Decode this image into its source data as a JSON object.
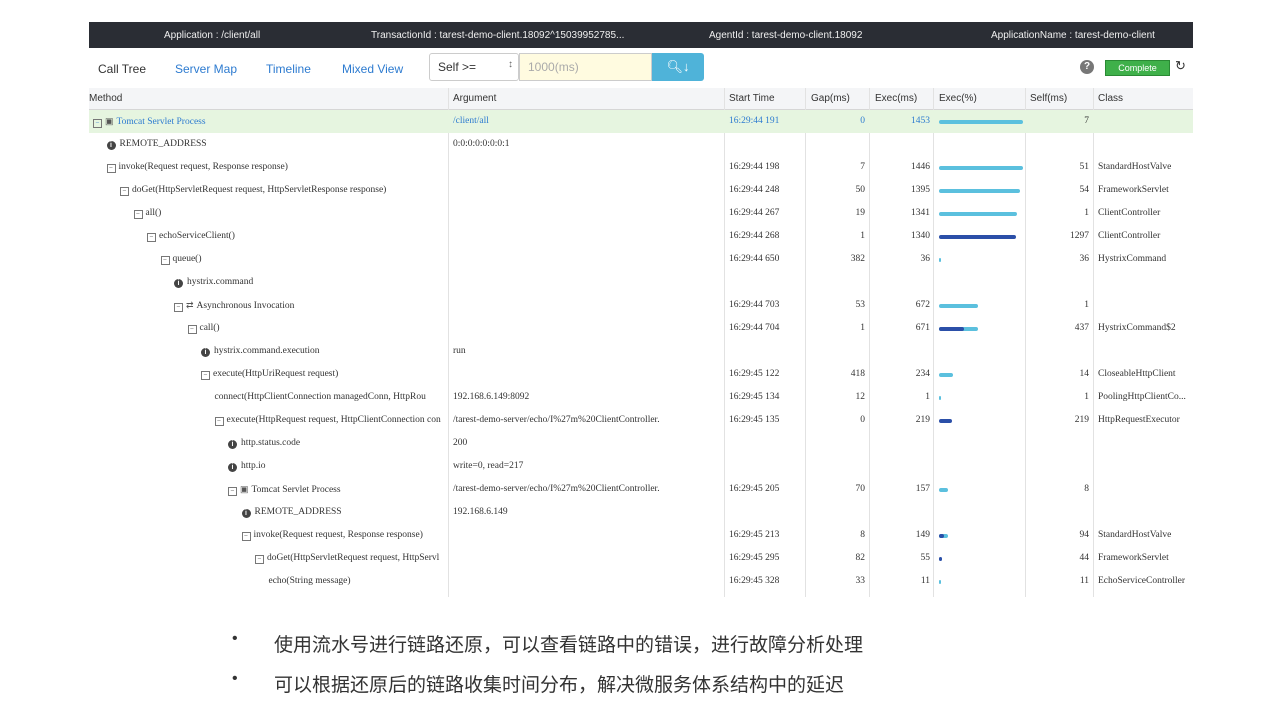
{
  "header": {
    "application": "Application : /client/all",
    "transaction": "TransactionId : tarest-demo-client.18092^15039952785...",
    "agent": "AgentId : tarest-demo-client.18092",
    "appname": "ApplicationName : tarest-demo-client"
  },
  "nav": {
    "tabs": [
      "Call Tree",
      "Server Map",
      "Timeline",
      "Mixed View"
    ],
    "filter_select": "Self >=",
    "filter_input_placeholder": "1000(ms)",
    "search_icon": "search-icon",
    "help": "?",
    "status": "Complete",
    "refresh_icon": "refresh-icon"
  },
  "columns": [
    "Method",
    "Argument",
    "Start Time",
    "Gap(ms)",
    "Exec(ms)",
    "Exec(%)",
    "Self(ms)",
    "Class"
  ],
  "rows": [
    {
      "method": "Tomcat Servlet Process",
      "arg": "/client/all",
      "start": "16:29:44 191",
      "gap": "0",
      "exec": "1453",
      "pct": 100,
      "self": "7",
      "class": "",
      "indent": 0,
      "node": "toggle-root",
      "hl": true
    },
    {
      "method": "REMOTE_ADDRESS",
      "arg": "0:0:0:0:0:0:0:1",
      "start": "",
      "gap": "",
      "exec": "",
      "pct": null,
      "self": "",
      "class": "",
      "indent": 1,
      "node": "info"
    },
    {
      "method": "invoke(Request request, Response response)",
      "arg": "",
      "start": "16:29:44 198",
      "gap": "7",
      "exec": "1446",
      "pct": 99.5,
      "self": "51",
      "class": "StandardHostValve",
      "indent": 1,
      "node": "toggle"
    },
    {
      "method": "doGet(HttpServletRequest request, HttpServletResponse response)",
      "arg": "",
      "start": "16:29:44 248",
      "gap": "50",
      "exec": "1395",
      "pct": 96,
      "self": "54",
      "class": "FrameworkServlet",
      "indent": 2,
      "node": "toggle"
    },
    {
      "method": "all()",
      "arg": "",
      "start": "16:29:44 267",
      "gap": "19",
      "exec": "1341",
      "pct": 92.3,
      "self": "1",
      "class": "ClientController",
      "indent": 3,
      "node": "toggle"
    },
    {
      "method": "echoServiceClient()",
      "arg": "",
      "start": "16:29:44 268",
      "gap": "1",
      "exec": "1340",
      "pct": 92.2,
      "self": "1297",
      "class": "ClientController",
      "indent": 4,
      "node": "toggle",
      "dark": true
    },
    {
      "method": "queue()",
      "arg": "",
      "start": "16:29:44 650",
      "gap": "382",
      "exec": "36",
      "pct": 2.5,
      "self": "36",
      "class": "HystrixCommand",
      "indent": 5,
      "node": "toggle"
    },
    {
      "method": "hystrix.command",
      "arg": "",
      "start": "",
      "gap": "",
      "exec": "",
      "pct": null,
      "self": "",
      "class": "",
      "indent": 6,
      "node": "info"
    },
    {
      "method": "Asynchronous Invocation",
      "arg": "",
      "start": "16:29:44 703",
      "gap": "53",
      "exec": "672",
      "pct": 46.2,
      "self": "1",
      "class": "",
      "indent": 6,
      "node": "toggle-async"
    },
    {
      "method": "call()",
      "arg": "",
      "start": "16:29:44 704",
      "gap": "1",
      "exec": "671",
      "pct": 46.2,
      "self": "437",
      "class": "HystrixCommand$2",
      "indent": 7,
      "node": "toggle",
      "partial": 65
    },
    {
      "method": "hystrix.command.execution",
      "arg": "run",
      "start": "",
      "gap": "",
      "exec": "",
      "pct": null,
      "self": "",
      "class": "",
      "indent": 8,
      "node": "info"
    },
    {
      "method": "execute(HttpUriRequest request)",
      "arg": "",
      "start": "16:29:45 122",
      "gap": "418",
      "exec": "234",
      "pct": 16.1,
      "self": "14",
      "class": "CloseableHttpClient",
      "indent": 8,
      "node": "toggle"
    },
    {
      "method": "connect(HttpClientConnection managedConn, HttpRou",
      "arg": "192.168.6.149:8092",
      "start": "16:29:45 134",
      "gap": "12",
      "exec": "1",
      "pct": 0.6,
      "self": "1",
      "class": "PoolingHttpClientCo...",
      "indent": 9,
      "node": "none"
    },
    {
      "method": "execute(HttpRequest request, HttpClientConnection con",
      "arg": "/tarest-demo-server/echo/I%27m%20ClientController.",
      "start": "16:29:45 135",
      "gap": "0",
      "exec": "219",
      "pct": 15,
      "self": "219",
      "class": "HttpRequestExecutor",
      "indent": 9,
      "node": "toggle",
      "dark": true
    },
    {
      "method": "http.status.code",
      "arg": "200",
      "start": "",
      "gap": "",
      "exec": "",
      "pct": null,
      "self": "",
      "class": "",
      "indent": 10,
      "node": "info"
    },
    {
      "method": "http.io",
      "arg": "write=0, read=217",
      "start": "",
      "gap": "",
      "exec": "",
      "pct": null,
      "self": "",
      "class": "",
      "indent": 10,
      "node": "info"
    },
    {
      "method": "Tomcat Servlet Process",
      "arg": "/tarest-demo-server/echo/I%27m%20ClientController.",
      "start": "16:29:45 205",
      "gap": "70",
      "exec": "157",
      "pct": 10.8,
      "self": "8",
      "class": "",
      "indent": 10,
      "node": "toggle-root"
    },
    {
      "method": "REMOTE_ADDRESS",
      "arg": "192.168.6.149",
      "start": "",
      "gap": "",
      "exec": "",
      "pct": null,
      "self": "",
      "class": "",
      "indent": 11,
      "node": "info"
    },
    {
      "method": "invoke(Request request, Response response)",
      "arg": "",
      "start": "16:29:45 213",
      "gap": "8",
      "exec": "149",
      "pct": 10.2,
      "self": "94",
      "class": "StandardHostValve",
      "indent": 11,
      "node": "toggle",
      "partial": 63
    },
    {
      "method": "doGet(HttpServletRequest request, HttpServl",
      "arg": "",
      "start": "16:29:45 295",
      "gap": "82",
      "exec": "55",
      "pct": 3.8,
      "self": "44",
      "class": "FrameworkServlet",
      "indent": 12,
      "node": "toggle",
      "dark": true
    },
    {
      "method": "echo(String message)",
      "arg": "",
      "start": "16:29:45 328",
      "gap": "33",
      "exec": "11",
      "pct": 0.8,
      "self": "11",
      "class": "EchoServiceController",
      "indent": 13,
      "node": "none"
    }
  ],
  "bullets": [
    "使用流水号进行链路还原，可以查看链路中的错误，进行故障分析处理",
    "可以根据还原后的链路收集时间分布，解决微服务体系结构中的延迟"
  ],
  "bullet_symbol": "•"
}
